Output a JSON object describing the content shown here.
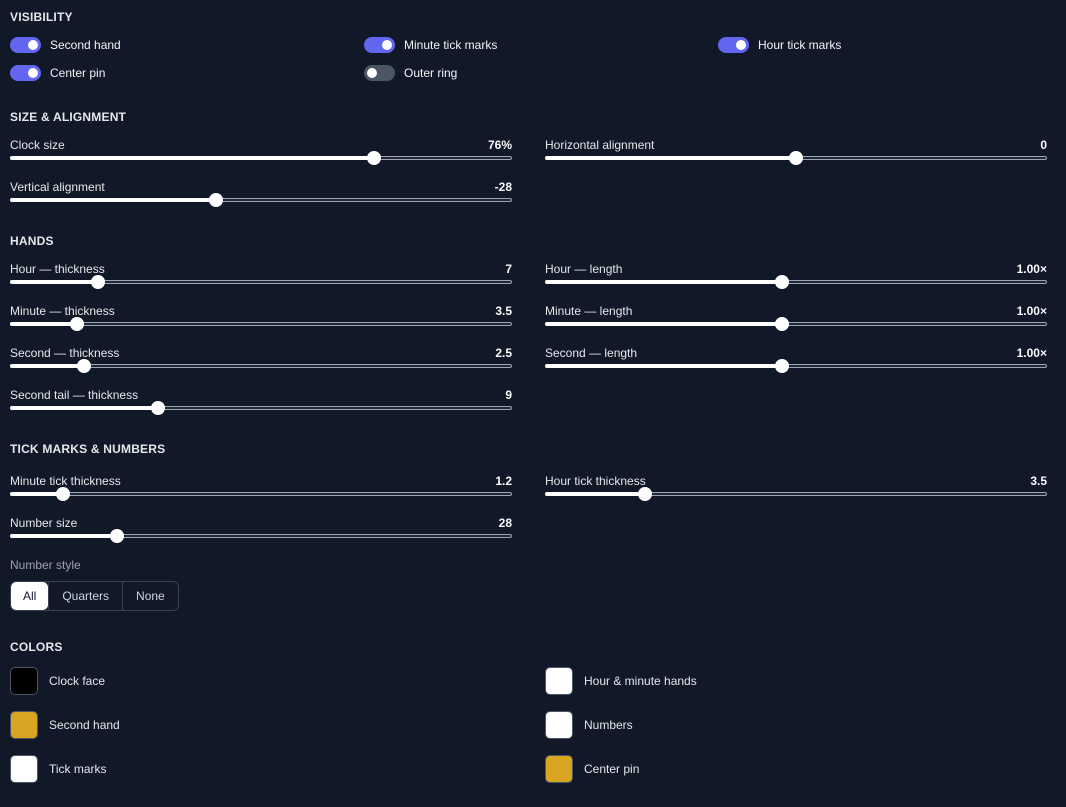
{
  "sections": {
    "visibility": "VISIBILITY",
    "size_alignment": "SIZE & ALIGNMENT",
    "hands": "HANDS",
    "ticks_numbers": "TICK MARKS & NUMBERS",
    "colors": "COLORS"
  },
  "visibility": [
    {
      "label": "Second hand",
      "on": true
    },
    {
      "label": "Minute tick marks",
      "on": true
    },
    {
      "label": "Hour tick marks",
      "on": true
    },
    {
      "label": "Center pin",
      "on": true
    },
    {
      "label": "Outer ring",
      "on": false
    }
  ],
  "sliders": {
    "clock_size": {
      "label": "Clock size",
      "value": "76%",
      "fraction": 0.725
    },
    "horizontal_alignment": {
      "label": "Horizontal alignment",
      "value": "0",
      "fraction": 0.5
    },
    "vertical_alignment": {
      "label": "Vertical alignment",
      "value": "-28",
      "fraction": 0.41
    },
    "hour_thickness": {
      "label": "Hour — thickness",
      "value": "7",
      "fraction": 0.175
    },
    "hour_length": {
      "label": "Hour — length",
      "value": "1.00×",
      "fraction": 0.473
    },
    "minute_thickness": {
      "label": "Minute — thickness",
      "value": "3.5",
      "fraction": 0.133
    },
    "minute_length": {
      "label": "Minute — length",
      "value": "1.00×",
      "fraction": 0.473
    },
    "second_thickness": {
      "label": "Second — thickness",
      "value": "2.5",
      "fraction": 0.148
    },
    "second_length": {
      "label": "Second — length",
      "value": "1.00×",
      "fraction": 0.473
    },
    "second_tail_thickness": {
      "label": "Second tail — thickness",
      "value": "9",
      "fraction": 0.295
    },
    "minute_tick_thickness": {
      "label": "Minute tick thickness",
      "value": "1.2",
      "fraction": 0.105
    },
    "hour_tick_thickness": {
      "label": "Hour tick thickness",
      "value": "3.5",
      "fraction": 0.2
    },
    "number_size": {
      "label": "Number size",
      "value": "28",
      "fraction": 0.214
    }
  },
  "number_style": {
    "label": "Number style",
    "options": [
      "All",
      "Quarters",
      "None"
    ],
    "selected": "All"
  },
  "colors": [
    {
      "label": "Clock face",
      "hex": "#000000"
    },
    {
      "label": "Hour & minute hands",
      "hex": "#ffffff"
    },
    {
      "label": "Second hand",
      "hex": "#d9a520"
    },
    {
      "label": "Numbers",
      "hex": "#ffffff"
    },
    {
      "label": "Tick marks",
      "hex": "#ffffff"
    },
    {
      "label": "Center pin",
      "hex": "#d9a520"
    }
  ],
  "theme": {
    "accent": "#6366f1",
    "background": "#111827"
  }
}
